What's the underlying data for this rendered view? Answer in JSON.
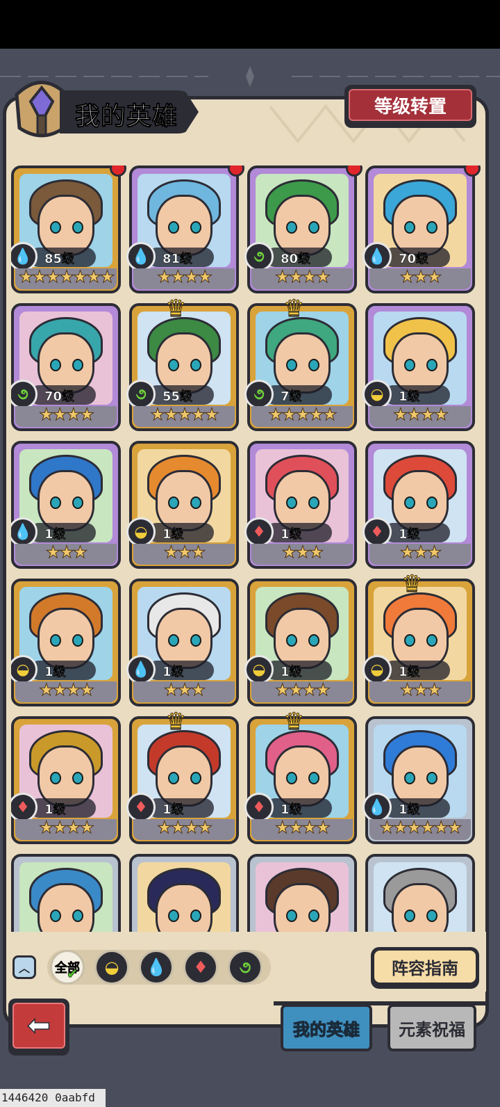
{
  "header": {
    "title": "我的英雄",
    "level_transfer_label": "等级转置"
  },
  "heroes": [
    {
      "level": "85级",
      "element": "water",
      "stars": "★★★★★★★",
      "rarity": "gold",
      "hair": "#7a5a3a",
      "badge": "red-dot"
    },
    {
      "level": "81级",
      "element": "water",
      "stars": "★★★★",
      "rarity": "purple",
      "hair": "#6fb7df",
      "badge": "red-dot"
    },
    {
      "level": "80级",
      "element": "wood",
      "stars": "★★★★",
      "rarity": "purple",
      "hair": "#3d9a4a",
      "badge": "red-dot"
    },
    {
      "level": "70级",
      "element": "water",
      "stars": "★★★",
      "rarity": "purple",
      "hair": "#3aa7d8",
      "badge": "red-dot"
    },
    {
      "level": "70级",
      "element": "wood",
      "stars": "★★★★",
      "rarity": "purple",
      "hair": "#38a7ac",
      "badge": ""
    },
    {
      "level": "55级",
      "element": "wood",
      "stars": "★★★★★",
      "rarity": "gold",
      "hair": "#3c8a44",
      "badge": "crown"
    },
    {
      "level": "7级",
      "element": "wood",
      "stars": "★★★★★",
      "rarity": "gold",
      "hair": "#3fa880",
      "badge": "crown"
    },
    {
      "level": "1级",
      "element": "earth",
      "stars": "★★★★",
      "rarity": "purple",
      "hair": "#f0c24a",
      "badge": ""
    },
    {
      "level": "1级",
      "element": "water",
      "stars": "★★★",
      "rarity": "purple",
      "hair": "#2f77c9",
      "badge": ""
    },
    {
      "level": "1级",
      "element": "earth",
      "stars": "★★★",
      "rarity": "gold",
      "hair": "#e58a2e",
      "badge": ""
    },
    {
      "level": "1级",
      "element": "fire",
      "stars": "★★★",
      "rarity": "purple",
      "hair": "#e0505a",
      "badge": ""
    },
    {
      "level": "1级",
      "element": "fire",
      "stars": "★★★",
      "rarity": "purple",
      "hair": "#dd4a3a",
      "badge": ""
    },
    {
      "level": "1级",
      "element": "earth",
      "stars": "★★★★",
      "rarity": "gold",
      "hair": "#d27a2a",
      "badge": ""
    },
    {
      "level": "1级",
      "element": "water",
      "stars": "★★★",
      "rarity": "gold",
      "hair": "#e8e8e8",
      "badge": ""
    },
    {
      "level": "1级",
      "element": "earth",
      "stars": "★★★★",
      "rarity": "gold",
      "hair": "#7a4a2a",
      "badge": ""
    },
    {
      "level": "1级",
      "element": "earth",
      "stars": "★★★",
      "rarity": "gold",
      "hair": "#ef7a3a",
      "badge": "crown"
    },
    {
      "level": "1级",
      "element": "fire",
      "stars": "★★★★",
      "rarity": "gold",
      "hair": "#c99a2a",
      "badge": ""
    },
    {
      "level": "1级",
      "element": "fire",
      "stars": "★★★★",
      "rarity": "gold",
      "hair": "#c43a2a",
      "badge": "crown"
    },
    {
      "level": "1级",
      "element": "fire",
      "stars": "★★★★",
      "rarity": "gold",
      "hair": "#e0608a",
      "badge": "crown"
    },
    {
      "level": "1级",
      "element": "water",
      "stars": "★★★★★★",
      "rarity": "silver",
      "hair": "#2f7bd8",
      "badge": ""
    },
    {
      "level": "",
      "element": "",
      "stars": "",
      "rarity": "silver",
      "hair": "#3a8ac8",
      "badge": ""
    },
    {
      "level": "",
      "element": "",
      "stars": "",
      "rarity": "silver",
      "hair": "#2a2a5a",
      "badge": ""
    },
    {
      "level": "",
      "element": "",
      "stars": "",
      "rarity": "silver",
      "hair": "#5a3a2a",
      "badge": ""
    },
    {
      "level": "",
      "element": "",
      "stars": "",
      "rarity": "silver",
      "hair": "#9a9a9a",
      "badge": ""
    }
  ],
  "element_icons": {
    "water": "💧",
    "wood": "૭",
    "earth": "◒",
    "fire": "♦"
  },
  "colors": {
    "water": "#2f8fe0",
    "wood": "#6fd13b",
    "earth": "#f0cd3a",
    "fire": "#ef5b5b"
  },
  "filters": {
    "toggle_icon": "︿",
    "all_label": "全部",
    "items": [
      "earth-filter-icon",
      "water-filter-icon",
      "fire-filter-icon",
      "wood-filter-icon"
    ]
  },
  "guide_button": "阵容指南",
  "tabs": {
    "my_heroes": "我的英雄",
    "element_blessing": "元素祝福"
  },
  "footer": {
    "id_text": "1446420 0aabfd"
  }
}
